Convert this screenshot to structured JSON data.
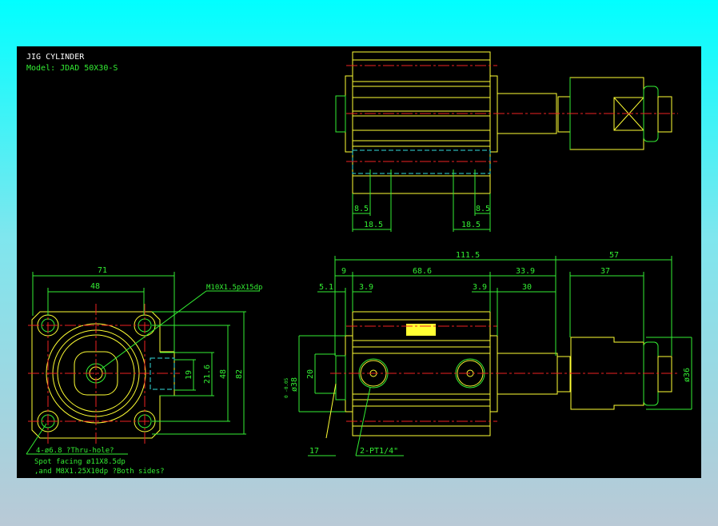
{
  "title": "JIG CYLINDER",
  "model": "Model: JDAD 50X30-S",
  "colors": {
    "background": "#000000",
    "outline": "#ffff33",
    "dimension": "#33ee33",
    "centerline": "#ee2222",
    "hidden": "#33dddd"
  },
  "top_view": {
    "dims": [
      "8.5",
      "18.5",
      "18.5",
      "8.5"
    ]
  },
  "side_view": {
    "dims_row1": [
      "111.5",
      "57"
    ],
    "dims_row2": [
      "9",
      "68.6",
      "33.9",
      "37"
    ],
    "dims_row3": [
      "5.1",
      "3.9",
      "3.9",
      "30"
    ],
    "dia_38": "ø38",
    "tol": "0 -0.05",
    "dim_20": "20",
    "dim_36": "ø36",
    "dim_17": "17",
    "port": "2-PT1/4\""
  },
  "front_view": {
    "dim_71": "71",
    "dim_48h": "48",
    "thread": "M10X1.5pX15dp",
    "dim_19": "19",
    "dim_21_6": "21.6",
    "dim_48v": "48",
    "dim_82": "82",
    "notes": [
      "4-ø6.8 ?Thru-hole?",
      "Spot facing ø11X8.5dp",
      ",and M8X1.25X10dp ?Both sides?"
    ]
  }
}
